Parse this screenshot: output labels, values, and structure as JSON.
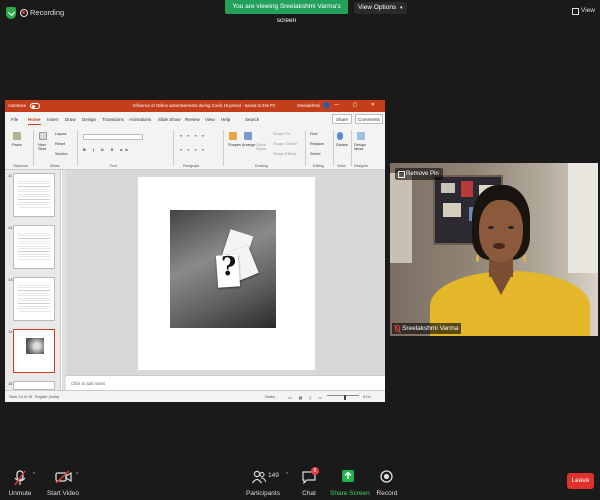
{
  "topbar": {
    "recording_label": "Recording",
    "viewing_banner": "You are viewing Sreelakshmi Varma's screen",
    "view_options": "View Options",
    "view_label": "View"
  },
  "ppt": {
    "autosave": "AutoSave",
    "toggle": "Off",
    "document_title": "Influence of Online advertisements during Covid 19 period - Saved to this PC",
    "user": "Sreelakshmi",
    "tabs": [
      "File",
      "Home",
      "Insert",
      "Draw",
      "Design",
      "Transitions",
      "Animations",
      "Slide Show",
      "Review",
      "View",
      "Help",
      "Search"
    ],
    "share": "Share",
    "comments": "Comments",
    "ribbon": {
      "paste": "Paste",
      "new_slide": "New Slide",
      "layout": "Layout",
      "reset": "Reset",
      "section": "Section",
      "shapes": "Shapes",
      "arrange": "Arrange",
      "quick_styles": "Quick Styles",
      "shape_fill": "Shape Fill",
      "shape_outline": "Shape Outline",
      "shape_effects": "Shape Effects",
      "find": "Find",
      "replace": "Replace",
      "select": "Select",
      "dictate": "Dictate",
      "design_ideas": "Design Ideas",
      "groups": [
        "Clipboard",
        "Slides",
        "Font",
        "Paragraph",
        "Drawing",
        "Editing",
        "Voice",
        "Designer"
      ]
    },
    "thumbnails": [
      "11",
      "12",
      "13",
      "14",
      "15"
    ],
    "notes_placeholder": "Click to add notes",
    "status": {
      "slide_of": "Slide 14 of 19",
      "language": "English (India)",
      "notes": "Notes",
      "zoom": "61%"
    }
  },
  "camera": {
    "remove_pin": "Remove Pin",
    "participant_name": "Sreelakshmi Varma"
  },
  "toolbar": {
    "unmute": "Unmute",
    "start_video": "Start Video",
    "participants": "Participants",
    "participants_count": "149",
    "chat": "Chat",
    "chat_badge": "6",
    "share_screen": "Share Screen",
    "record": "Record",
    "leave": "Leave"
  },
  "colors": {
    "banner_green": "#23a15c",
    "ppt_red": "#c43e1c",
    "leave_red": "#e0322c",
    "share_green": "#23b24c"
  }
}
